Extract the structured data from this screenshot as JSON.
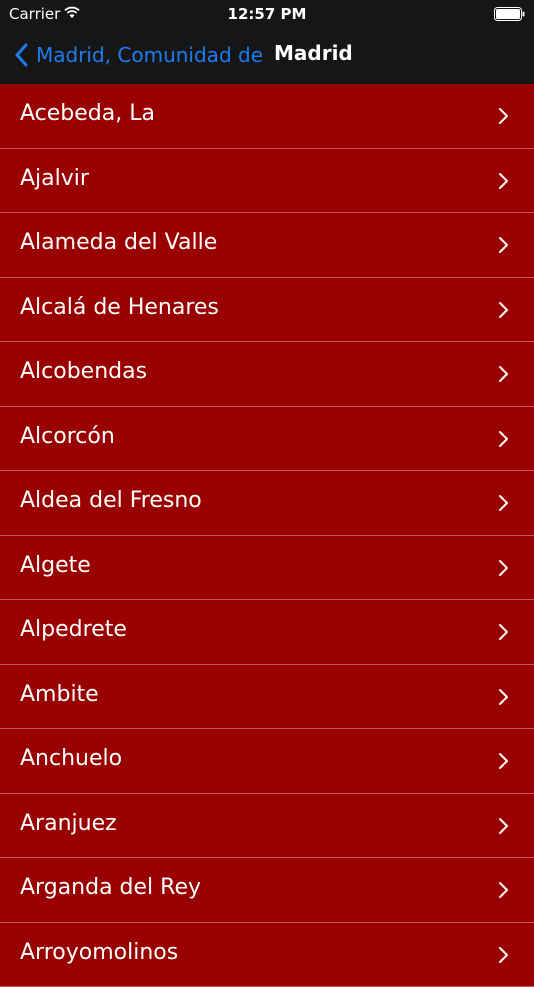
{
  "status_bar": {
    "carrier": "Carrier",
    "time": "12:57 PM",
    "icons": [
      "wifi-icon",
      "battery-icon"
    ]
  },
  "nav_bar": {
    "back_label": "Madrid, Comunidad de",
    "title": "Madrid",
    "back_icon": "chevron-left-icon",
    "accent_color": "#1e7cf0"
  },
  "list": {
    "background_color": "#990000",
    "items": [
      {
        "label": "Acebeda, La"
      },
      {
        "label": "Ajalvir"
      },
      {
        "label": "Alameda del Valle"
      },
      {
        "label": "Alcalá de Henares"
      },
      {
        "label": "Alcobendas"
      },
      {
        "label": "Alcorcón"
      },
      {
        "label": "Aldea del Fresno"
      },
      {
        "label": "Algete"
      },
      {
        "label": "Alpedrete"
      },
      {
        "label": "Ambite"
      },
      {
        "label": "Anchuelo"
      },
      {
        "label": "Aranjuez"
      },
      {
        "label": "Arganda del Rey"
      },
      {
        "label": "Arroyomolinos"
      }
    ]
  }
}
